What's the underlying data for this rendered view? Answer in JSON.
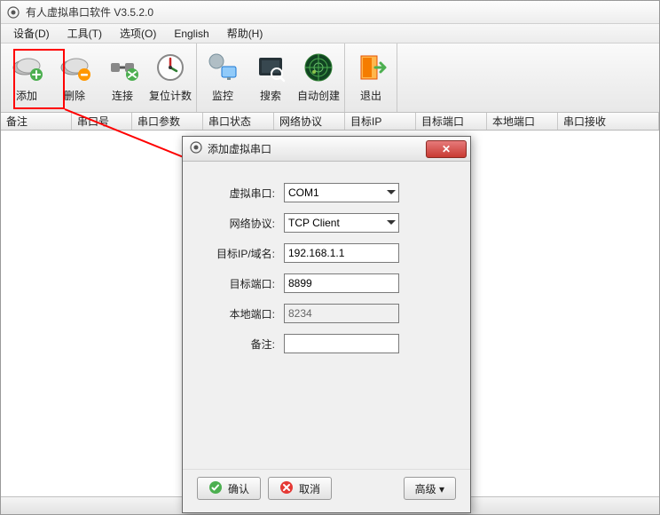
{
  "window": {
    "title": "有人虚拟串口软件 V3.5.2.0"
  },
  "menu": {
    "device": "设备(D)",
    "tools": "工具(T)",
    "options": "选项(O)",
    "english": "English",
    "help": "帮助(H)"
  },
  "toolbar": {
    "add": "添加",
    "delete": "删除",
    "connect": "连接",
    "reset_counter": "复位计数",
    "monitor": "监控",
    "search": "搜索",
    "auto_create": "自动创建",
    "exit": "退出"
  },
  "columns": {
    "remark": "备注",
    "com_no": "串口号",
    "com_params": "串口参数",
    "com_status": "串口状态",
    "net_proto": "网络协议",
    "target_ip": "目标IP",
    "target_port": "目标端口",
    "local_port": "本地端口",
    "com_recv": "串口接收"
  },
  "dialog": {
    "title": "添加虚拟串口",
    "labels": {
      "virtual_com": "虚拟串口:",
      "net_proto": "网络协议:",
      "target_ip": "目标IP/域名:",
      "target_port": "目标端口:",
      "local_port": "本地端口:",
      "remark": "备注:"
    },
    "values": {
      "virtual_com": "COM1",
      "net_proto": "TCP Client",
      "target_ip": "192.168.1.1",
      "target_port": "8899",
      "local_port": "8234",
      "remark": ""
    },
    "buttons": {
      "ok": "确认",
      "cancel": "取消",
      "advanced": "高级 ▾"
    }
  }
}
